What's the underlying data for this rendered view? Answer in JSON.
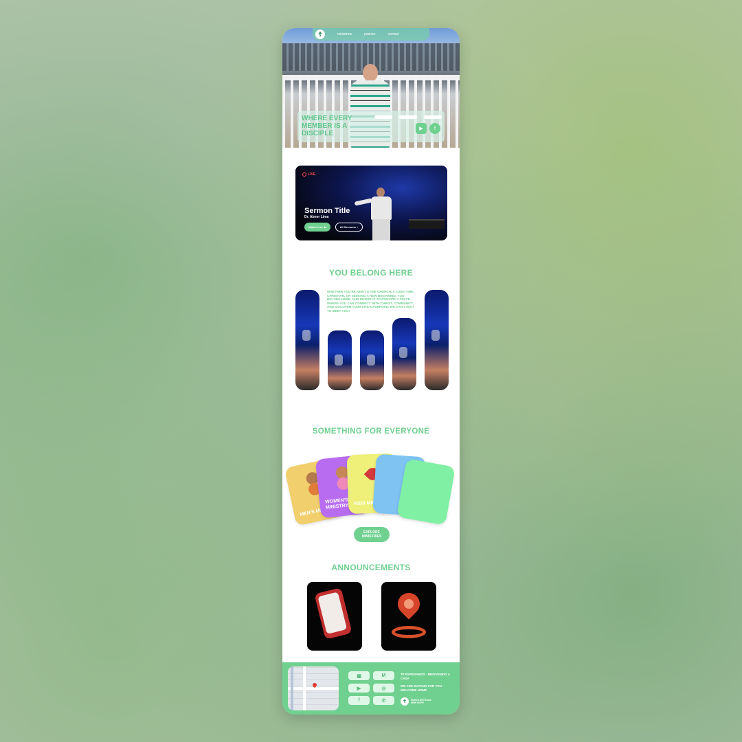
{
  "nav": {
    "logo_glyph": "☦",
    "links": [
      "ministries",
      "pastors",
      "contact"
    ]
  },
  "hero": {
    "title": "WHERE EVERY MEMBER IS A DISCIPLE",
    "pills": [
      "",
      "",
      ""
    ],
    "service_times": "",
    "social": [
      "youtube-icon",
      "facebook-icon"
    ]
  },
  "sermon": {
    "live_label": "LIVE",
    "title": "Sermon Title",
    "speaker": "Dr. Abner Lima",
    "watch_label": "Watch Live",
    "all_label": "All Sermons"
  },
  "belong": {
    "heading": "YOU BELONG HERE",
    "body": "WHETHER YOU'RE NEW TO THE CHURCH, A LONG-TIME CHRISTIAN, OR SEEKING A NEW BEGINNING, YOU BELONG HERE. OUR DESIRE IS TO PROVIDE A SPACE WHERE YOU CAN CONNECT WITH CHRIST, COMMUNITY, AND DISCOVER YOUR LIFE'S PURPOSE. WE CAN'T WAIT TO MEET YOU!"
  },
  "ministries": {
    "heading": "SOMETHING FOR EVERYONE",
    "cards": [
      {
        "label": "MEN'S MINISTRY",
        "color": "#f1cf6c"
      },
      {
        "label": "WOMEN'S MINISTRY",
        "color": "#b86df0"
      },
      {
        "label": "KIDS MINISTRY",
        "color": "#eef07a"
      },
      {
        "label": "",
        "color": "#7ec3f2"
      },
      {
        "label": "",
        "color": "#7ff0a4"
      }
    ],
    "explore_label": "EXPLORE MINISTRIES"
  },
  "announcements": {
    "heading": "ANNOUNCEMENTS",
    "items": [
      "phone-icon",
      "location-pin-icon"
    ]
  },
  "footer": {
    "buttons": [
      "calendar-icon",
      "gmail-icon",
      "youtube-icon",
      "instagram-icon",
      "facebook-icon",
      "phone-icon"
    ],
    "tagline_es": "TE ESPERAMOS - BIENVENIDO A CASA",
    "tagline_en": "WE ARE WAITING FOR YOU - WELCOME HOME",
    "logo_text": "NUEVA ENTRADA NEW HOPE"
  },
  "colors": {
    "accent": "#6fd08f",
    "text_light": "#ffffff"
  }
}
